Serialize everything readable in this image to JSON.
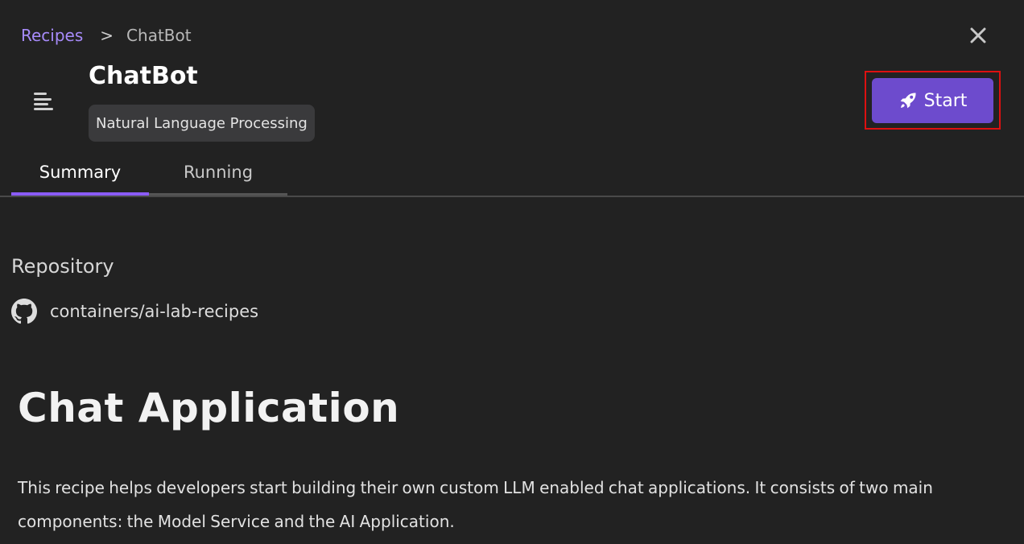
{
  "breadcrumb": {
    "parent": "Recipes",
    "separator": ">",
    "current": "ChatBot"
  },
  "header": {
    "title": "ChatBot",
    "category_badge": "Natural Language Processing",
    "start_label": "Start"
  },
  "tabs": [
    {
      "label": "Summary",
      "active": true
    },
    {
      "label": "Running",
      "active": false
    }
  ],
  "repository": {
    "heading": "Repository",
    "link_text": "containers/ai-lab-recipes"
  },
  "readme": {
    "title": "Chat Application",
    "paragraph": "This recipe helps developers start building their own custom LLM enabled chat applications. It consists of two main components: the Model Service and the AI Application."
  },
  "icons": {
    "close": "close-icon",
    "menu": "menu-lines-icon",
    "start": "rocket-icon",
    "repo": "github-icon"
  },
  "colors": {
    "background": "#222222",
    "accent": "#8b5cf6",
    "start_button": "#6d4bcd",
    "breadcrumb_link": "#a78bfa",
    "highlight_border": "#dd1111",
    "badge_bg": "#3a3a3c"
  }
}
